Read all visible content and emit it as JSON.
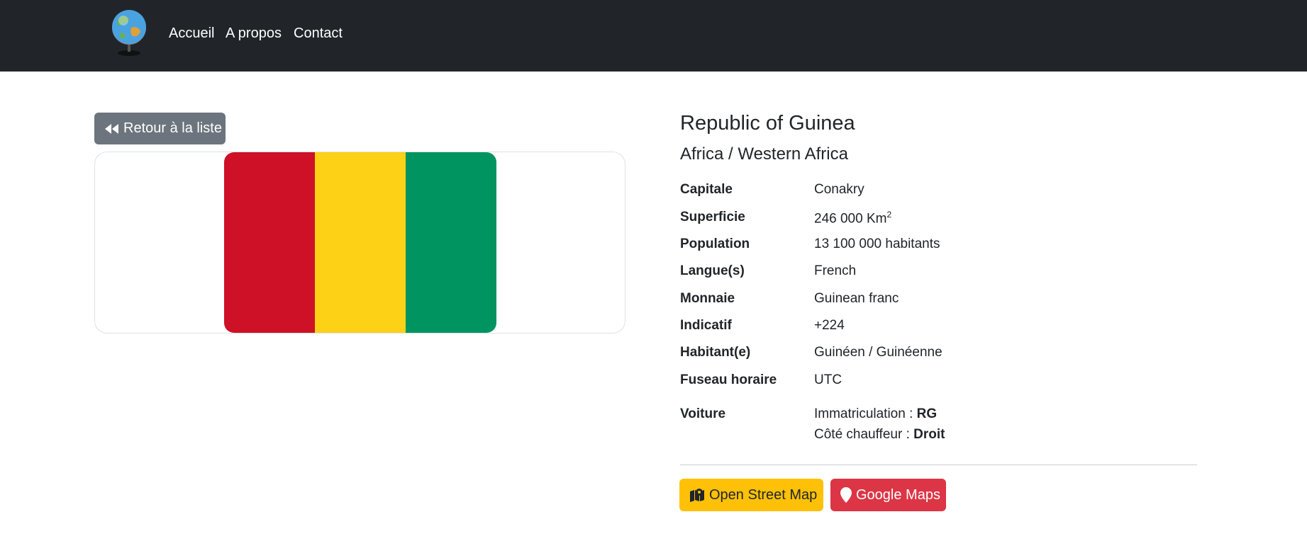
{
  "nav": {
    "logo_icon": "globe-icon",
    "links": [
      "Accueil",
      "A propos",
      "Contact"
    ]
  },
  "back_button": {
    "label": "Retour à la liste",
    "icon": "backward-icon"
  },
  "flag": {
    "colors": [
      "#ce1126",
      "#fcd116",
      "#009460"
    ]
  },
  "country": {
    "name": "Republic of Guinea",
    "region": "Africa / Western Africa"
  },
  "details": {
    "capitale": {
      "label": "Capitale",
      "value": "Conakry"
    },
    "superficie": {
      "label": "Superficie",
      "value": "246 000 Km",
      "unit_exp": "2"
    },
    "population": {
      "label": "Population",
      "value": "13 100 000 habitants"
    },
    "langues": {
      "label": "Langue(s)",
      "value": "French"
    },
    "monnaie": {
      "label": "Monnaie",
      "value": "Guinean franc"
    },
    "indicatif": {
      "label": "Indicatif",
      "value": "+224"
    },
    "habitant": {
      "label": "Habitant(e)",
      "value": "Guinéen / Guinéenne"
    },
    "fuseau": {
      "label": "Fuseau horaire",
      "value": "UTC"
    },
    "voiture": {
      "label": "Voiture",
      "immat_label": "Immatriculation : ",
      "immat_value": "RG",
      "cote_label": "Côté chauffeur : ",
      "cote_value": "Droit"
    }
  },
  "actions": {
    "osm": {
      "label": "Open Street Map",
      "icon": "map-icon",
      "color": "#ffc107"
    },
    "google": {
      "label": "Google Maps",
      "icon": "map-marker-icon",
      "color": "#dc3545"
    }
  }
}
